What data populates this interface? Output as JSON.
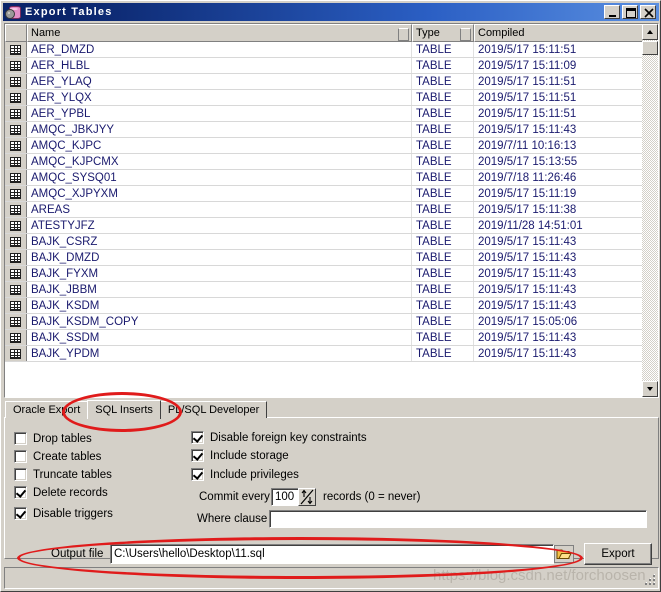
{
  "window": {
    "title": "Export Tables",
    "icon": "database-gear-icon",
    "controls": [
      {
        "name": "minimize-button",
        "glyph": "_"
      },
      {
        "name": "maximize-button",
        "glyph": "□"
      },
      {
        "name": "close-button",
        "glyph": "✕"
      }
    ]
  },
  "grid": {
    "columns": [
      "",
      "Name",
      "Type",
      "Compiled"
    ],
    "rows": [
      {
        "name": "AER_DMZD",
        "type": "TABLE",
        "compiled": "2019/5/17 15:11:51"
      },
      {
        "name": "AER_HLBL",
        "type": "TABLE",
        "compiled": "2019/5/17 15:11:09"
      },
      {
        "name": "AER_YLAQ",
        "type": "TABLE",
        "compiled": "2019/5/17 15:11:51"
      },
      {
        "name": "AER_YLQX",
        "type": "TABLE",
        "compiled": "2019/5/17 15:11:51"
      },
      {
        "name": "AER_YPBL",
        "type": "TABLE",
        "compiled": "2019/5/17 15:11:51"
      },
      {
        "name": "AMQC_JBKJYY",
        "type": "TABLE",
        "compiled": "2019/5/17 15:11:43"
      },
      {
        "name": "AMQC_KJPC",
        "type": "TABLE",
        "compiled": "2019/7/11 10:16:13"
      },
      {
        "name": "AMQC_KJPCMX",
        "type": "TABLE",
        "compiled": "2019/5/17 15:13:55"
      },
      {
        "name": "AMQC_SYSQ01",
        "type": "TABLE",
        "compiled": "2019/7/18 11:26:46"
      },
      {
        "name": "AMQC_XJPYXM",
        "type": "TABLE",
        "compiled": "2019/5/17 15:11:19"
      },
      {
        "name": "AREAS",
        "type": "TABLE",
        "compiled": "2019/5/17 15:11:38"
      },
      {
        "name": "ATESTYJFZ",
        "type": "TABLE",
        "compiled": "2019/11/28 14:51:01"
      },
      {
        "name": "BAJK_CSRZ",
        "type": "TABLE",
        "compiled": "2019/5/17 15:11:43"
      },
      {
        "name": "BAJK_DMZD",
        "type": "TABLE",
        "compiled": "2019/5/17 15:11:43"
      },
      {
        "name": "BAJK_FYXM",
        "type": "TABLE",
        "compiled": "2019/5/17 15:11:43"
      },
      {
        "name": "BAJK_JBBM",
        "type": "TABLE",
        "compiled": "2019/5/17 15:11:43"
      },
      {
        "name": "BAJK_KSDM",
        "type": "TABLE",
        "compiled": "2019/5/17 15:11:43"
      },
      {
        "name": "BAJK_KSDM_COPY",
        "type": "TABLE",
        "compiled": "2019/5/17 15:05:06"
      },
      {
        "name": "BAJK_SSDM",
        "type": "TABLE",
        "compiled": "2019/5/17 15:11:43"
      },
      {
        "name": "BAJK_YPDM",
        "type": "TABLE",
        "compiled": "2019/5/17 15:11:43"
      }
    ]
  },
  "tabs": [
    {
      "label": "Oracle Export",
      "active": false
    },
    {
      "label": "SQL Inserts",
      "active": true
    },
    {
      "label": "PL/SQL Developer",
      "active": false
    }
  ],
  "options": {
    "left_column": [
      {
        "label": "Drop tables",
        "checked": false
      },
      {
        "label": "Create tables",
        "checked": false
      },
      {
        "label": "Truncate tables",
        "checked": false
      },
      {
        "label": "Delete records",
        "checked": true
      },
      {
        "label": "Disable triggers",
        "checked": true
      }
    ],
    "right_column": [
      {
        "label": "Disable foreign key constraints",
        "checked": true
      },
      {
        "label": "Include storage",
        "checked": true
      },
      {
        "label": "Include privileges",
        "checked": true
      }
    ],
    "commit_every_label": "Commit every",
    "commit_every_value": "100",
    "commit_every_suffix": "records (0 = never)",
    "where_clause_label": "Where clause",
    "where_clause_value": ""
  },
  "output": {
    "label": "Output file",
    "value": "C:\\Users\\hello\\Desktop\\11.sql",
    "browse_icon": "open-folder-icon",
    "export_label": "Export"
  },
  "watermark": "https://blog.csdn.net/forchoosen",
  "colors": {
    "titlebar_start": "#0a246a",
    "titlebar_end": "#5a8fe0",
    "face": "#d4d0c8",
    "grid_text": "#1a1a6e",
    "annotation": "#e01b1b"
  }
}
